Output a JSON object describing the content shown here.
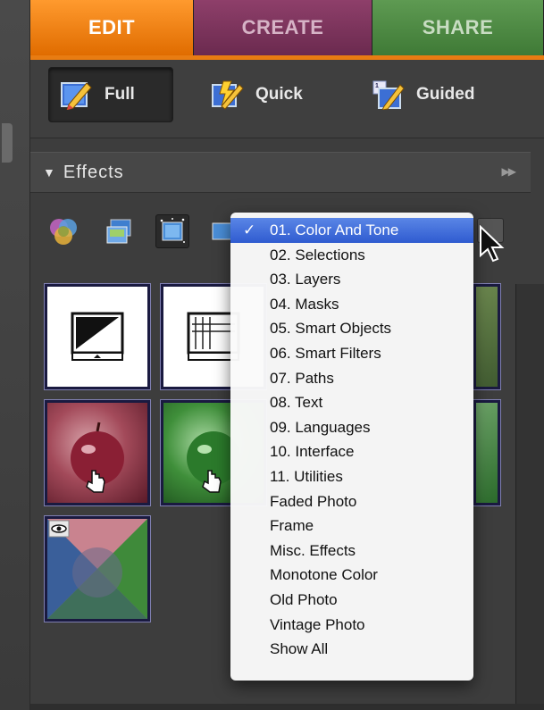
{
  "tabs": [
    {
      "label": "EDIT"
    },
    {
      "label": "CREATE"
    },
    {
      "label": "SHARE"
    }
  ],
  "modes": [
    {
      "label": "Full",
      "selected": true
    },
    {
      "label": "Quick"
    },
    {
      "label": "Guided"
    }
  ],
  "effects_panel": {
    "title": "Effects",
    "toolbar_icons": [
      "layer-styles-icon",
      "photo-effects-icon",
      "filters-icon",
      "all-effects-icon"
    ]
  },
  "category_menu": {
    "selected": "01. Color And Tone",
    "items": [
      "01. Color And Tone",
      "02. Selections",
      "03. Layers",
      "04. Masks",
      "05. Smart Objects",
      "06. Smart Filters",
      "07. Paths",
      "08. Text",
      "09. Languages",
      "10. Interface",
      "11. Utilities",
      "Faded Photo",
      "Frame",
      "Misc. Effects",
      "Monotone Color",
      "Old Photo",
      "Vintage Photo",
      "Show All"
    ]
  },
  "colors": {
    "edit_tab": "#e87c12",
    "create_tab": "#7a3259",
    "share_tab": "#4a8a40",
    "menu_highlight": "#3b66d8"
  }
}
